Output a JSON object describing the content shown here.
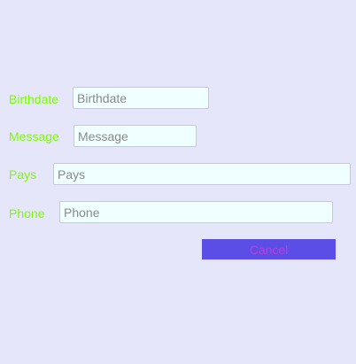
{
  "form": {
    "fields": [
      {
        "label": "Birthdate",
        "placeholder": "Birthdate",
        "value": ""
      },
      {
        "label": "Message",
        "placeholder": "Message",
        "value": ""
      },
      {
        "label": "Pays",
        "placeholder": "Pays",
        "value": ""
      },
      {
        "label": "Phone",
        "placeholder": "Phone",
        "value": ""
      }
    ],
    "cancel_label": "Cancel"
  },
  "colors": {
    "background": "#e6e6fa",
    "label": "#7cfc00",
    "input_background": "#f0ffff",
    "button_background": "#5b4ee6",
    "button_text": "#c23bdb"
  }
}
